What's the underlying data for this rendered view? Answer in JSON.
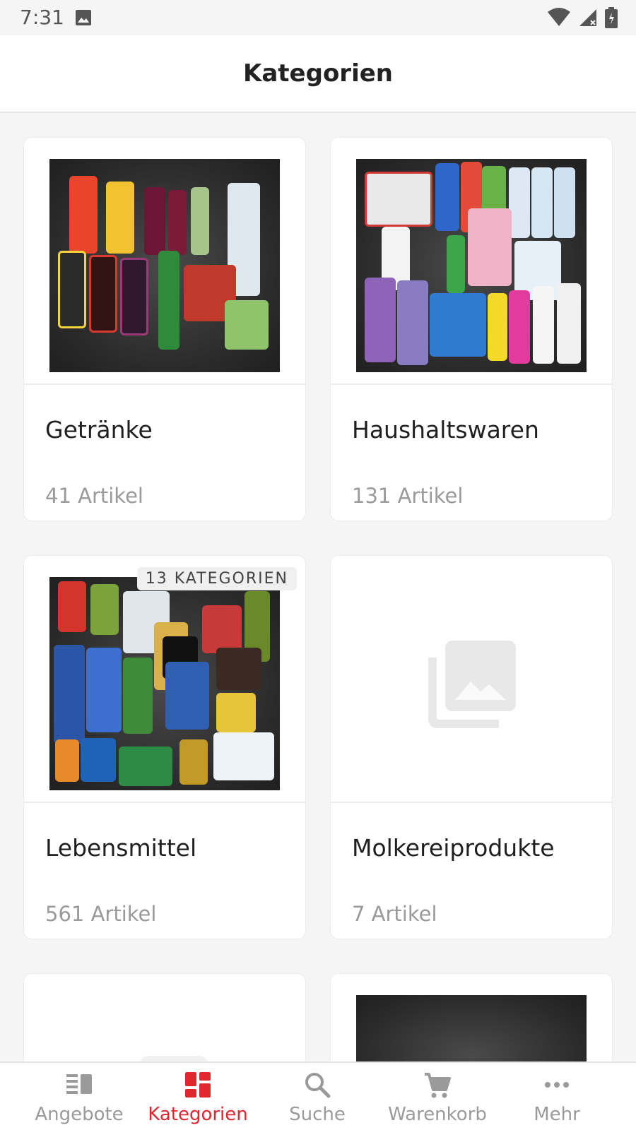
{
  "status_bar": {
    "time": "7:31",
    "icons": [
      "photo-icon",
      "wifi-icon",
      "signal-icon",
      "battery-icon"
    ]
  },
  "header": {
    "title": "Kategorien"
  },
  "categories": [
    {
      "name": "Getränke",
      "count": "41 Artikel",
      "badge": ""
    },
    {
      "name": "Haushaltswaren",
      "count": "131 Artikel",
      "badge": ""
    },
    {
      "name": "Lebensmittel",
      "count": "561 Artikel",
      "badge": "13 KATEGORIEN"
    },
    {
      "name": "Molkereiprodukte",
      "count": "7 Artikel",
      "badge": ""
    }
  ],
  "bottom_nav": {
    "items": [
      {
        "label": "Angebote",
        "icon": "offers-icon"
      },
      {
        "label": "Kategorien",
        "icon": "categories-icon",
        "active": true
      },
      {
        "label": "Suche",
        "icon": "search-icon"
      },
      {
        "label": "Warenkorb",
        "icon": "cart-icon"
      },
      {
        "label": "Mehr",
        "icon": "more-icon"
      }
    ]
  },
  "colors": {
    "accent": "#e0262f",
    "inactive": "#9a9a9a",
    "background": "#f5f5f5"
  }
}
